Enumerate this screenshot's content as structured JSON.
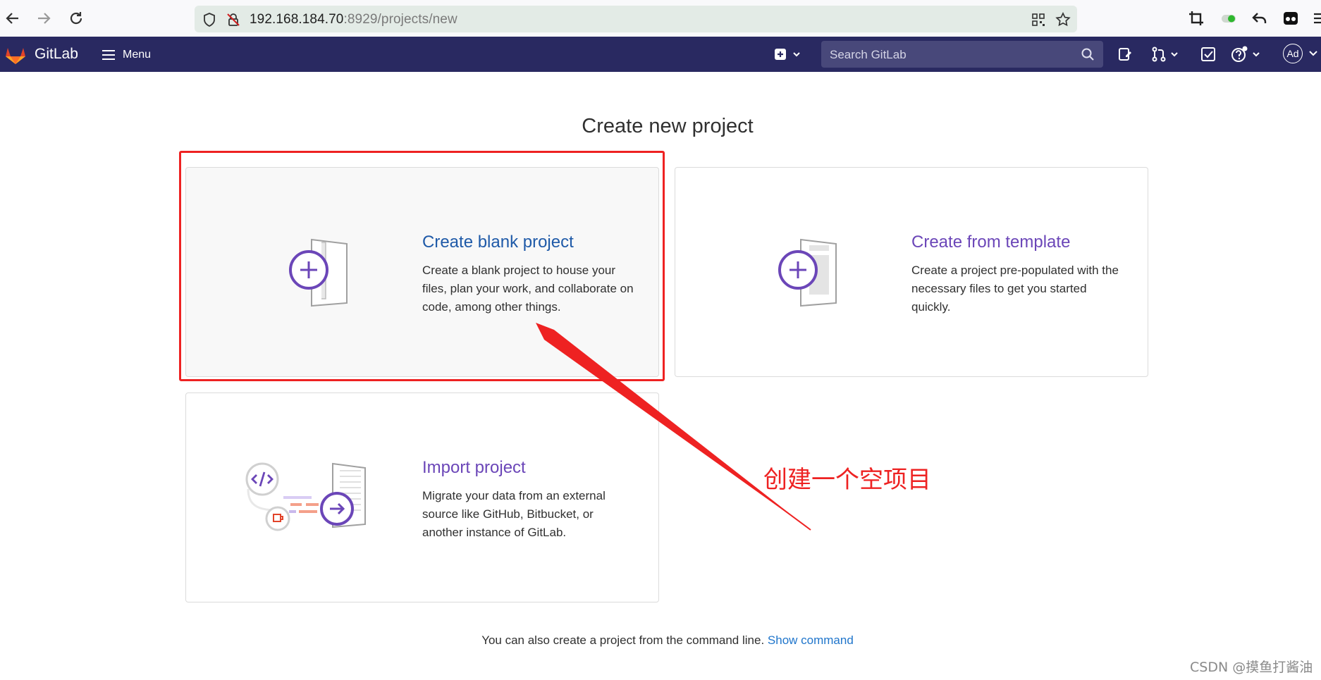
{
  "browser": {
    "url_host": "192.168.184.70",
    "url_path": ":8929/projects/new"
  },
  "header": {
    "app_name": "GitLab",
    "menu_label": "Menu",
    "search_placeholder": "Search GitLab",
    "avatar_initials": "Ad"
  },
  "page": {
    "title": "Create new project"
  },
  "cards": {
    "blank": {
      "title": "Create blank project",
      "description": "Create a blank project to house your files, plan your work, and collaborate on code, among other things."
    },
    "template": {
      "title": "Create from template",
      "description": "Create a project pre-populated with the necessary files to get you started quickly."
    },
    "import": {
      "title": "Import project",
      "description": "Migrate your data from an external source like GitHub, Bitbucket, or another instance of GitLab."
    }
  },
  "footer": {
    "text": "You can also create a project from the command line.",
    "link": "Show command"
  },
  "annotation": {
    "text": "创建一个空项目"
  },
  "watermark": "CSDN @摸鱼打酱油",
  "colors": {
    "header_bg": "#292961",
    "highlight": "#ee2222",
    "link_blue": "#1f5aa8",
    "link_purple": "#6b46b8"
  }
}
